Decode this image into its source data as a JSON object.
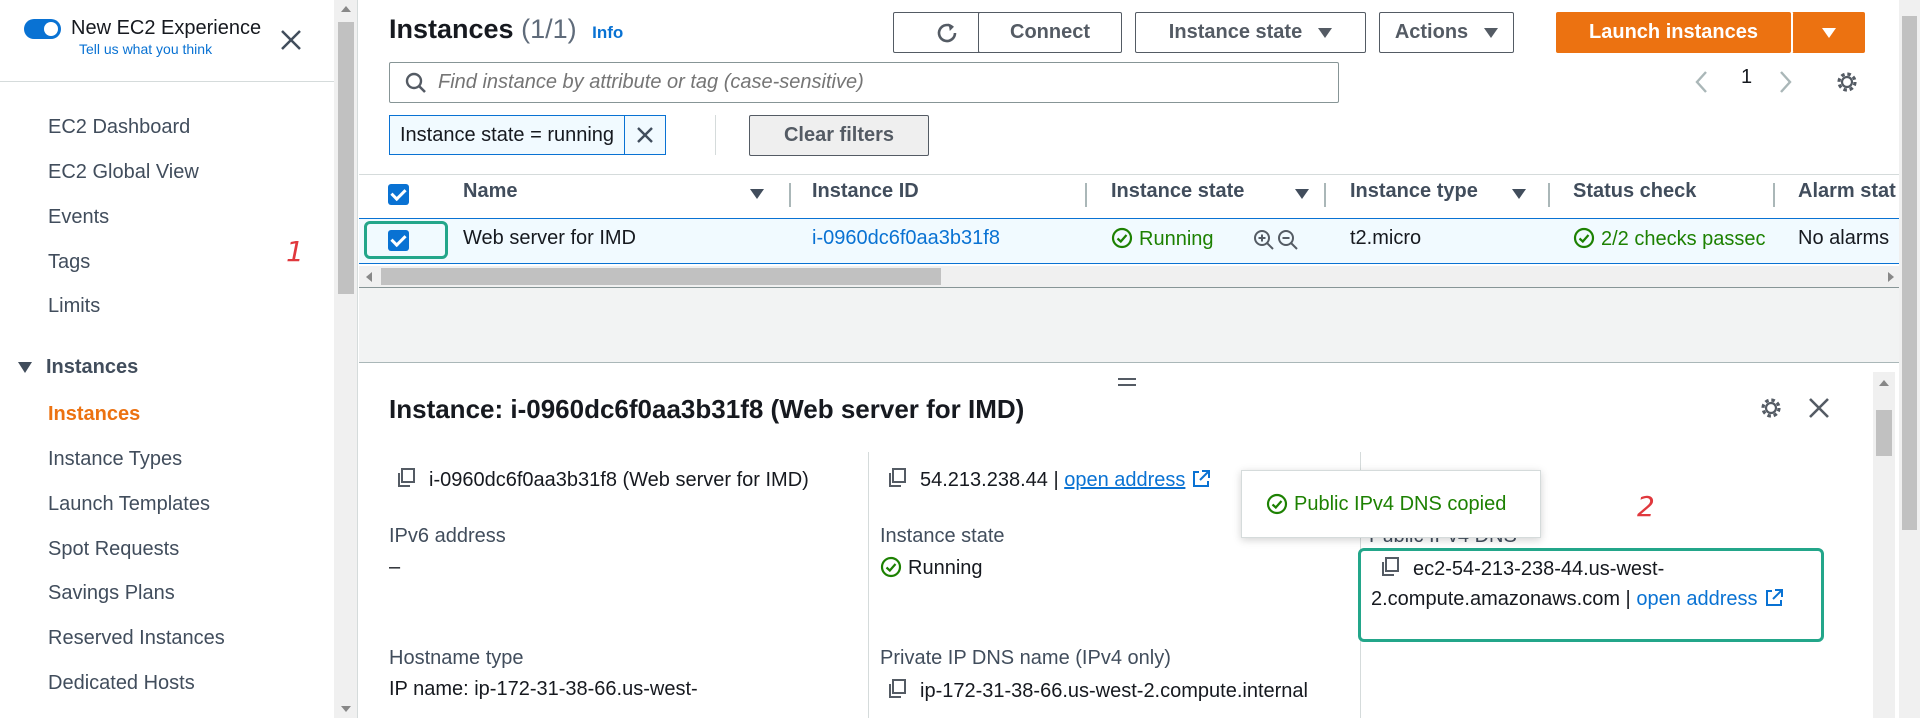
{
  "sidebar": {
    "toggle_title": "New EC2 Experience",
    "toggle_subtitle": "Tell us what you think",
    "items": [
      {
        "label": "EC2 Dashboard"
      },
      {
        "label": "EC2 Global View"
      },
      {
        "label": "Events"
      },
      {
        "label": "Tags"
      },
      {
        "label": "Limits"
      }
    ],
    "section": "Instances",
    "section_items": [
      {
        "label": "Instances",
        "active": true
      },
      {
        "label": "Instance Types"
      },
      {
        "label": "Launch Templates"
      },
      {
        "label": "Spot Requests"
      },
      {
        "label": "Savings Plans"
      },
      {
        "label": "Reserved Instances"
      },
      {
        "label": "Dedicated Hosts"
      }
    ],
    "annotation": "1"
  },
  "header": {
    "title": "Instances",
    "count": "(1/1)",
    "info": "Info",
    "connect": "Connect",
    "instance_state": "Instance state",
    "actions": "Actions",
    "launch": "Launch instances"
  },
  "search": {
    "placeholder": "Find instance by attribute or tag (case-sensitive)"
  },
  "pager": {
    "page": "1"
  },
  "filter": {
    "token": "Instance state = running",
    "clear": "Clear filters"
  },
  "table": {
    "columns": [
      "Name",
      "Instance ID",
      "Instance state",
      "Instance type",
      "Status check",
      "Alarm stat"
    ],
    "row": {
      "name": "Web server for IMD",
      "instance_id": "i-0960dc6f0aa3b31f8",
      "state": "Running",
      "type": "t2.micro",
      "status": "2/2 checks passec",
      "alarm": "No alarms"
    }
  },
  "details": {
    "title": "Instance: i-0960dc6f0aa3b31f8 (Web server for IMD)",
    "instance_summary": "i-0960dc6f0aa3b31f8 (Web server for IMD)",
    "public_ip": "54.213.238.44 |",
    "open_address": "open address",
    "ipv6_label": "IPv6 address",
    "ipv6_value": "–",
    "state_label": "Instance state",
    "state_value": "Running",
    "dns_label": "Public IPv4 DNS",
    "dns_line1": "ec2-54-213-238-44.us-west-",
    "dns_line2": "2.compute.amazonaws.com |",
    "dns_open": "open address",
    "hostname_label": "Hostname type",
    "hostname_value": "IP name: ip-172-31-38-66.us-west-",
    "private_dns_label": "Private IP DNS name (IPv4 only)",
    "private_dns_value": "ip-172-31-38-66.us-west-2.compute.internal",
    "annotation": "2"
  },
  "toast": {
    "message": "Public IPv4 DNS copied"
  },
  "colors": {
    "accent": "#0972d3",
    "primary": "#ec7211",
    "success": "#1d8102",
    "highlight": "#23a68a",
    "annotation": "#e0383d"
  }
}
